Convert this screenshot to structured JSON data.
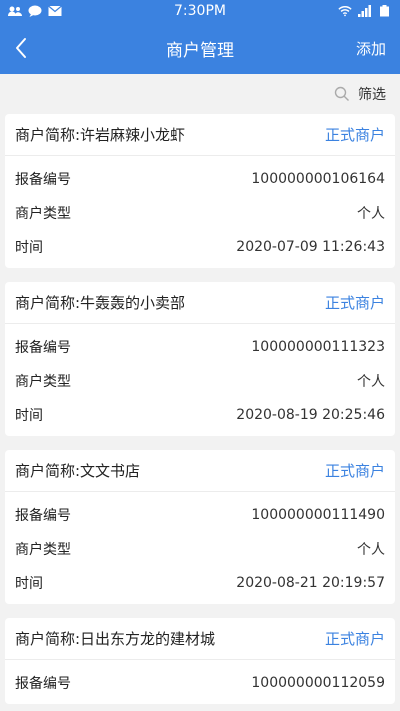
{
  "status_bar": {
    "time": "7:30PM"
  },
  "header": {
    "title": "商户管理",
    "action_label": "添加"
  },
  "filter": {
    "label": "筛选"
  },
  "labels": {
    "filing_no": "报备编号",
    "merchant_type": "商户类型",
    "time": "时间"
  },
  "merchants": [
    {
      "name": "商户简称:许岩麻辣小龙虾",
      "status": "正式商户",
      "filing_no": "100000000106164",
      "type": "个人",
      "time": "2020-07-09 11:26:43"
    },
    {
      "name": "商户简称:牛轰轰的小卖部",
      "status": "正式商户",
      "filing_no": "100000000111323",
      "type": "个人",
      "time": "2020-08-19 20:25:46"
    },
    {
      "name": "商户简称:文文书店",
      "status": "正式商户",
      "filing_no": "100000000111490",
      "type": "个人",
      "time": "2020-08-21 20:19:57"
    },
    {
      "name": "商户简称:日出东方龙的建材城",
      "status": "正式商户",
      "filing_no": "100000000112059"
    }
  ],
  "colors": {
    "primary": "#3b82e0",
    "background": "#f2f2f2"
  }
}
